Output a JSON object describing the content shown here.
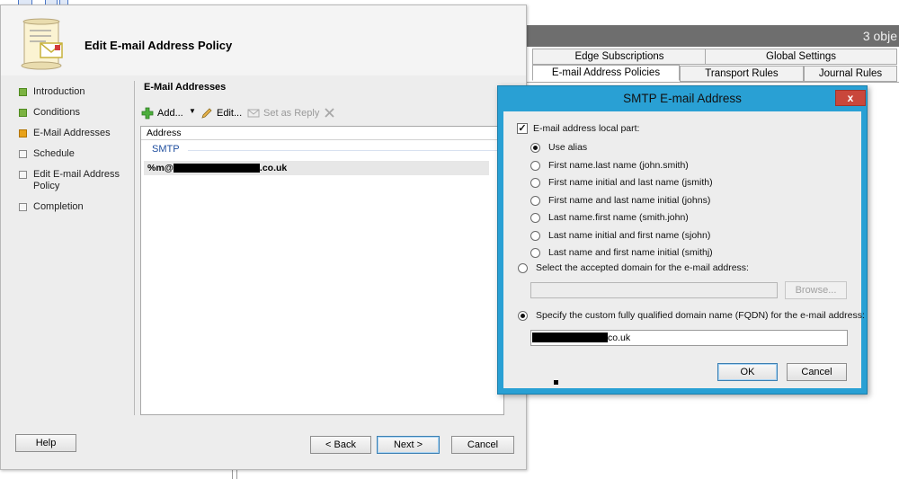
{
  "background_console": {
    "object_count": "3 obje",
    "tabs_row1": [
      "Edge Subscriptions",
      "Global Settings"
    ],
    "tabs_row2": [
      "E-mail Address Policies",
      "Transport Rules",
      "Journal Rules"
    ]
  },
  "wizard": {
    "title": "Edit E-mail Address Policy",
    "steps": [
      {
        "label": "Introduction",
        "state": "done"
      },
      {
        "label": "Conditions",
        "state": "done"
      },
      {
        "label": "E-Mail Addresses",
        "state": "current"
      },
      {
        "label": "Schedule",
        "state": "pending"
      },
      {
        "label": "Edit E-mail Address Policy",
        "state": "pending"
      },
      {
        "label": "Completion",
        "state": "pending"
      }
    ],
    "section_title": "E-Mail Addresses",
    "toolbar": {
      "add_label": "Add...",
      "edit_label": "Edit...",
      "set_reply_label": "Set as Reply"
    },
    "list": {
      "column_header": "Address",
      "group": "SMTP",
      "row_prefix": "%m@",
      "row_suffix": ".co.uk"
    },
    "buttons": {
      "help": "Help",
      "back": "< Back",
      "next": "Next >",
      "cancel": "Cancel"
    }
  },
  "smtp_dialog": {
    "title": "SMTP E-mail Address",
    "close_glyph": "x",
    "local_part_label": "E-mail address local part:",
    "local_part_checked": true,
    "local_part_options": [
      "Use alias",
      "First name.last name (john.smith)",
      "First name initial and last name (jsmith)",
      "First name and last name initial (johns)",
      "Last name.first name (smith.john)",
      "Last name initial and first name (sjohn)",
      "Last name and first name initial (smithj)"
    ],
    "local_part_selected_index": 0,
    "accepted_domain_label": "Select the accepted domain for the e-mail address:",
    "accepted_domain_value": "",
    "browse_label": "Browse...",
    "custom_fqdn_label": "Specify the custom fully qualified domain name (FQDN) for the e-mail address:",
    "custom_fqdn_suffix": "co.uk",
    "domain_mode": "custom_fqdn",
    "ok_label": "OK",
    "cancel_label": "Cancel"
  }
}
